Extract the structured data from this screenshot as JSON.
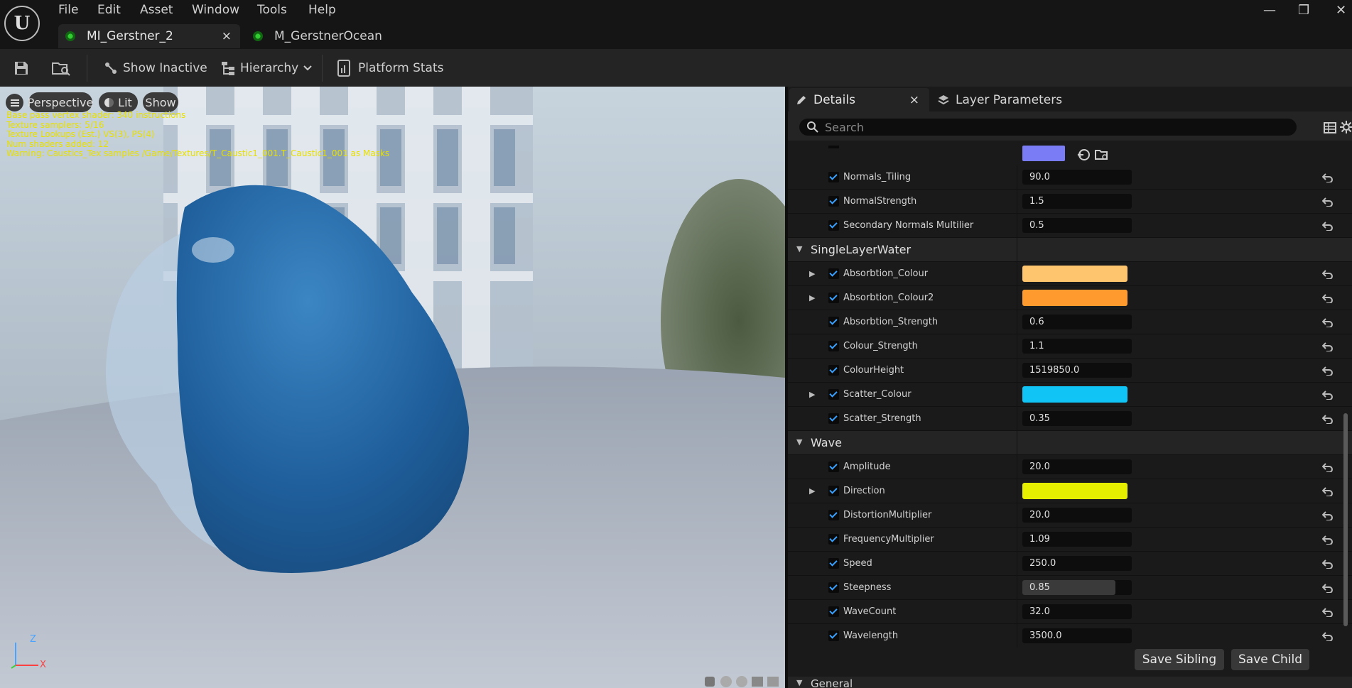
{
  "app": {
    "logo": "U",
    "menu": [
      "File",
      "Edit",
      "Asset",
      "Window",
      "Tools",
      "Help"
    ],
    "tabs": [
      {
        "label": "MI_Gerstner_2",
        "close": "×"
      },
      {
        "label": "M_GerstnerOcean"
      }
    ],
    "window_controls": {
      "minimize": "—",
      "restore": "❐",
      "close": "✕"
    }
  },
  "toolbar": {
    "show_inactive": "Show Inactive",
    "hierarchy": "Hierarchy",
    "platform_stats": "Platform Stats"
  },
  "viewport": {
    "buttons": {
      "perspective": "Perspective",
      "lit": "Lit",
      "show": "Show"
    },
    "stats": [
      "Base pass vertex shader: 340 instructions",
      "Texture samplers: 5/16",
      "Texture Lookups (Est.) VS(3), PS(4)",
      "Num shaders added: 12",
      "Warning: Caustics_Tex samples /Game/Textures/T_Caustic1_001.T_Caustic1_001 as Masks"
    ],
    "axes": {
      "z": "Z",
      "x": "X"
    }
  },
  "details": {
    "tab_details": "Details",
    "tab_close": "×",
    "tab_layer": "Layer Parameters",
    "search_placeholder": "Search",
    "top_rows": [
      {
        "label": "Normals_Tiling",
        "value": "90.0"
      },
      {
        "label": "NormalStrength",
        "value": "1.5"
      },
      {
        "label": "Secondary Normals Multilier",
        "value": "0.5"
      }
    ],
    "single_layer_water": {
      "title": "SingleLayerWater",
      "rows": [
        {
          "label": "Absorbtion_Colour",
          "color": "#ffc46e",
          "expand": true
        },
        {
          "label": "Absorbtion_Colour2",
          "color": "#ff9a2e",
          "expand": true
        },
        {
          "label": "Absorbtion_Strength",
          "value": "0.6"
        },
        {
          "label": "Colour_Strength",
          "value": "1.1"
        },
        {
          "label": "ColourHeight",
          "value": "1519850.0"
        },
        {
          "label": "Scatter_Colour",
          "color": "#10c4f6",
          "expand": true
        },
        {
          "label": "Scatter_Strength",
          "value": "0.35"
        }
      ]
    },
    "wave": {
      "title": "Wave",
      "rows": [
        {
          "label": "Amplitude",
          "value": "20.0"
        },
        {
          "label": "Direction",
          "color": "#e6ef00",
          "expand": true
        },
        {
          "label": "DistortionMultiplier",
          "value": "20.0"
        },
        {
          "label": "FrequencyMultiplier",
          "value": "1.09"
        },
        {
          "label": "Speed",
          "value": "250.0"
        },
        {
          "label": "Steepness",
          "value": "0.85",
          "fill": 0.85
        },
        {
          "label": "WaveCount",
          "value": "32.0"
        },
        {
          "label": "Wavelength",
          "value": "3500.0"
        }
      ]
    },
    "save_sibling": "Save Sibling",
    "save_child": "Save Child",
    "general": "General",
    "normal_swatch_color": "#7a7cf6"
  }
}
